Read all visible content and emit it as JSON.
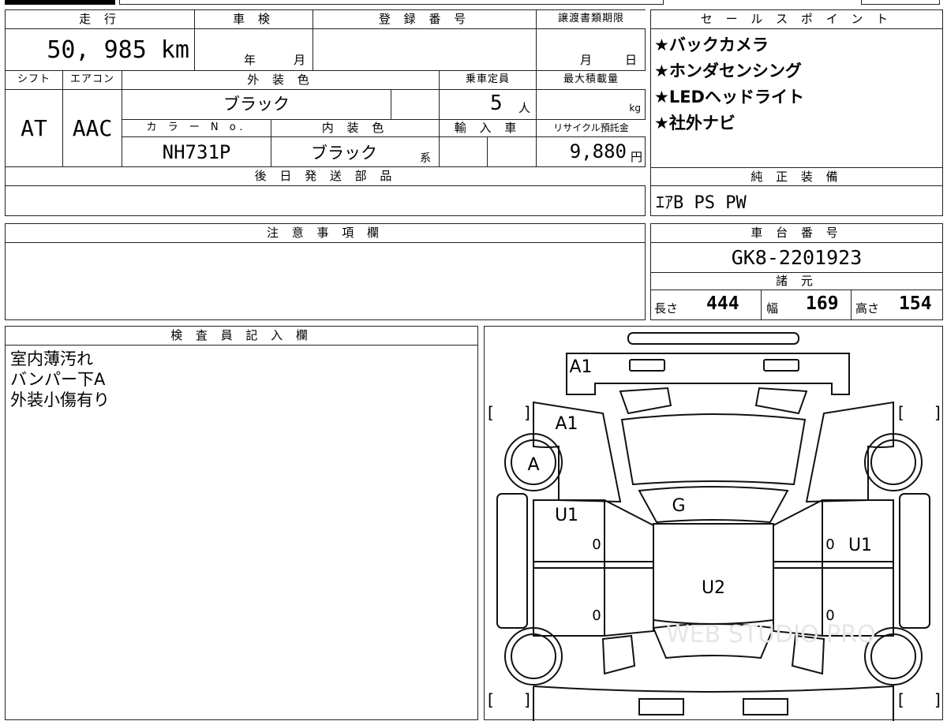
{
  "vehicle": {
    "mileage_label": "走 行",
    "mileage": "50, 985 km",
    "inspection_label": "車 検",
    "inspection_year": "年",
    "inspection_month": "月",
    "registration_label": "登 録 番 号",
    "registration": "",
    "transfer_label": "譲渡書類期限",
    "transfer_month": "月",
    "transfer_day": "日",
    "shift_label": "シフト",
    "shift": "AT",
    "aircon_label": "エアコン",
    "aircon": "AAC",
    "exterior_label": "外 装 色",
    "exterior": "ブラック",
    "capacity_label": "乗車定員",
    "capacity": "5",
    "capacity_unit": "人",
    "maxload_label": "最大積載量",
    "maxload_unit": "kg",
    "color_no_label": "カ ラ ー N o.",
    "color_no": "NH731P",
    "interior_label": "内 装 色",
    "interior": "ブラック",
    "interior_suffix": "系",
    "import_label": "輸 入 車",
    "recycle_label": "リサイクル預託金",
    "recycle": "9,880",
    "recycle_unit": "円",
    "later_parts_label": "後 日 発 送 部 品"
  },
  "sales": {
    "label": "セ ー ル ス ポ イ ン ト",
    "points": [
      "★バックカメラ",
      "★ホンダセンシング",
      "★LEDヘッドライト",
      "★社外ナビ"
    ]
  },
  "genuine": {
    "label": "純 正 装 備",
    "value": "ｴｱB PS PW"
  },
  "caution": {
    "label": "注 意 事 項 欄"
  },
  "chassis": {
    "label": "車 台 番 号",
    "value": "GK8-2201923"
  },
  "specs": {
    "label": "諸 元",
    "length_label": "長さ",
    "length": "444",
    "width_label": "幅",
    "width": "169",
    "height_label": "高さ",
    "height": "154"
  },
  "inspector": {
    "label": "検 査 員 記 入 欄",
    "notes": [
      "室内薄汚れ",
      "バンパー下A",
      "外装小傷有り"
    ]
  },
  "diagram": {
    "marks": [
      "A1",
      "A1",
      "A",
      "G",
      "U1",
      "U1",
      "U2",
      "0",
      "0",
      "0",
      "0"
    ],
    "brackets": [
      "[",
      "]",
      "[",
      "]",
      "[",
      "]",
      "[",
      "]"
    ],
    "watermark": "WEB STUDIO PRO"
  }
}
